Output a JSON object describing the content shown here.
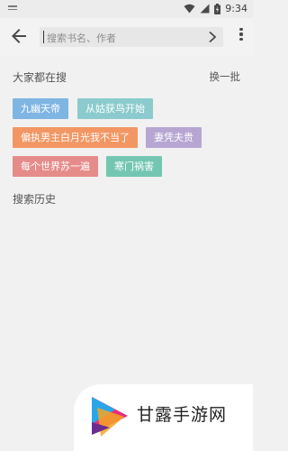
{
  "status_bar": {
    "time": "9:34"
  },
  "search": {
    "placeholder": "搜索书名、作者",
    "value": ""
  },
  "hot": {
    "title": "大家都在搜",
    "refresh_label": "换一批",
    "tags": [
      {
        "label": "九幽天帝",
        "color": "#7fb5e3"
      },
      {
        "label": "从姑获鸟开始",
        "color": "#8ccbcd"
      },
      {
        "label": "偏执男主白月光我不当了",
        "color": "#f29764"
      },
      {
        "label": "妻凭夫贵",
        "color": "#b7a6d2"
      },
      {
        "label": "每个世界苏一遍",
        "color": "#e58c8b"
      },
      {
        "label": "寒门祸害",
        "color": "#74c6b2"
      }
    ]
  },
  "history": {
    "title": "搜索历史"
  },
  "watermark": {
    "text": "甘露手游网"
  }
}
